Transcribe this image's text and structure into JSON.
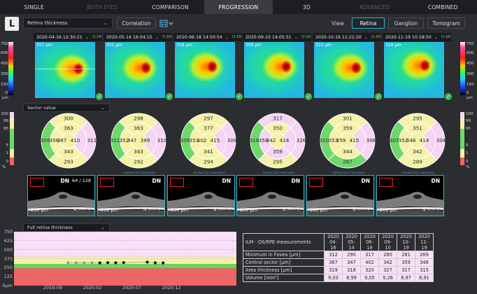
{
  "nav": {
    "tabs": [
      {
        "label": "SINGLE",
        "state": "normal"
      },
      {
        "label": "BOTH EYES",
        "state": "disabled"
      },
      {
        "label": "COMPARISON",
        "state": "normal"
      },
      {
        "label": "PROGRESSION",
        "state": "active"
      },
      {
        "label": "3D",
        "state": "normal"
      },
      {
        "label": "ADVANCED",
        "state": "disabled"
      },
      {
        "label": "COMBINED",
        "state": "normal"
      }
    ]
  },
  "toolbar": {
    "eye": "L",
    "map_type": "Retina thickness",
    "correlation": "Correlation",
    "view_label": "View",
    "view_buttons": [
      {
        "label": "Retina",
        "active": true
      },
      {
        "label": "Ganglion",
        "active": false
      },
      {
        "label": "Tomogram",
        "active": false
      }
    ]
  },
  "exams": [
    {
      "date": "2020-04-16 12:30:21",
      "q": "Q:",
      "qn": "10",
      "map_um": "357 µm",
      "sector": {
        "s": "300",
        "c": "363",
        "ni": "356",
        "cc": "367",
        "ti": "410",
        "no": "309",
        "to": "311",
        "ii": "343",
        "io": "293"
      }
    },
    {
      "date": "2020-05-14 16:04:15",
      "q": "Q:",
      "qn": "10",
      "map_um": "331 µm",
      "sector": {
        "s": "298",
        "c": "363",
        "ni": "352",
        "cc": "347",
        "ti": "399",
        "no": "311",
        "to": "310",
        "ii": "343",
        "io": "292"
      }
    },
    {
      "date": "2020-06-18 14:50:54",
      "q": "Q:",
      "qn": "10",
      "map_um": "316 µm",
      "sector": {
        "s": "297",
        "c": "377",
        "ni": "351",
        "cc": "402",
        "ti": "415",
        "no": "309",
        "to": "309",
        "ii": "341",
        "io": "294"
      }
    },
    {
      "date": "2020-09-10 14:05:51",
      "q": "Q:",
      "qn": "10",
      "map_um": "309 µm",
      "sector": {
        "s": "317",
        "c": "350",
        "ni": "358",
        "cc": "342",
        "ti": "424",
        "no": "316",
        "to": "326",
        "ii": "359",
        "io": "295"
      }
    },
    {
      "date": "2020-10-19 11:21:20",
      "q": "Q:",
      "qn": "10",
      "map_um": "322 µm",
      "sector": {
        "s": "301",
        "c": "359",
        "ni": "353",
        "cc": "359",
        "ti": "415",
        "no": "310",
        "to": "306",
        "ii": "344",
        "io": "287"
      }
    },
    {
      "date": "2020-11-19 10:18:50",
      "q": "Q:",
      "qn": "10",
      "map_um": "328 µm",
      "sector": {
        "s": "295",
        "c": "351",
        "ni": "352",
        "cc": "348",
        "ti": "414",
        "no": "307",
        "to": "304",
        "ii": "342",
        "io": "289"
      }
    }
  ],
  "colorbar": {
    "labels": [
      "750",
      "600",
      "450",
      "300",
      "150",
      "0"
    ],
    "unit": "µm"
  },
  "sector_select": "Sector value",
  "percent_bar": {
    "labels": [
      "100",
      "99",
      "95",
      "5",
      "1",
      "0"
    ],
    "unit": "%"
  },
  "oct": {
    "dn": "DN",
    "count": "64 / 128",
    "scale": "200 µm",
    "n": "N",
    "t": "T",
    "extracted": "EXTRACTED TOMOGRAM"
  },
  "trend": {
    "select": "Full retina thickness",
    "yticks": [
      "750",
      "625",
      "500",
      "375",
      "250",
      "125",
      "0µm"
    ],
    "xticks": [
      "2019-09",
      "2020-02",
      "2020-07",
      "2020-12"
    ]
  },
  "chart_data": {
    "type": "scatter",
    "title": "Full retina thickness",
    "xlabel": "",
    "ylabel": "µm",
    "ylim": [
      0,
      750
    ],
    "x_ticks": [
      "2019-09",
      "2020-02",
      "2020-07",
      "2020-12"
    ],
    "series": [
      {
        "name": "",
        "points": [
          {
            "x": "2019-11",
            "y": 320,
            "kind": "grey"
          },
          {
            "x": "2019-12",
            "y": 318,
            "kind": "grey"
          },
          {
            "x": "2020-01",
            "y": 316,
            "kind": "grey"
          },
          {
            "x": "2020-02",
            "y": 317,
            "kind": "grey"
          },
          {
            "x": "2020-03",
            "y": 315,
            "kind": "black"
          },
          {
            "x": "2020-04",
            "y": 319,
            "kind": "black"
          },
          {
            "x": "2020-05",
            "y": 318,
            "kind": "black"
          },
          {
            "x": "2020-06",
            "y": 320,
            "kind": "black"
          },
          {
            "x": "2020-09",
            "y": 327,
            "kind": "black"
          },
          {
            "x": "2020-10",
            "y": 317,
            "kind": "black"
          },
          {
            "x": "2020-11",
            "y": 315,
            "kind": "black"
          }
        ]
      }
    ]
  },
  "table": {
    "title": "ILM - OS/RPE measurements",
    "cols": [
      {
        "y": "2020",
        "md": "04-16"
      },
      {
        "y": "2020",
        "md": "05-14"
      },
      {
        "y": "2020",
        "md": "06-18"
      },
      {
        "y": "2020",
        "md": "09-10"
      },
      {
        "y": "2020",
        "md": "10-19"
      },
      {
        "y": "2020",
        "md": "11-19"
      }
    ],
    "rows": [
      {
        "label": "Minimum in Fovea [µm]",
        "values": [
          "312",
          "290",
          "317",
          "280",
          "281",
          "269"
        ]
      },
      {
        "label": "Central sector [µm]",
        "values": [
          "367",
          "347",
          "402",
          "342",
          "359",
          "348"
        ]
      },
      {
        "label": "Area thickness [µm]",
        "values": [
          "319",
          "318",
          "320",
          "327",
          "317",
          "315"
        ]
      },
      {
        "label": "Volume [mm³]",
        "values": [
          "9,03",
          "8,99",
          "9,05",
          "9,26",
          "8,97",
          "8,91"
        ]
      }
    ]
  }
}
